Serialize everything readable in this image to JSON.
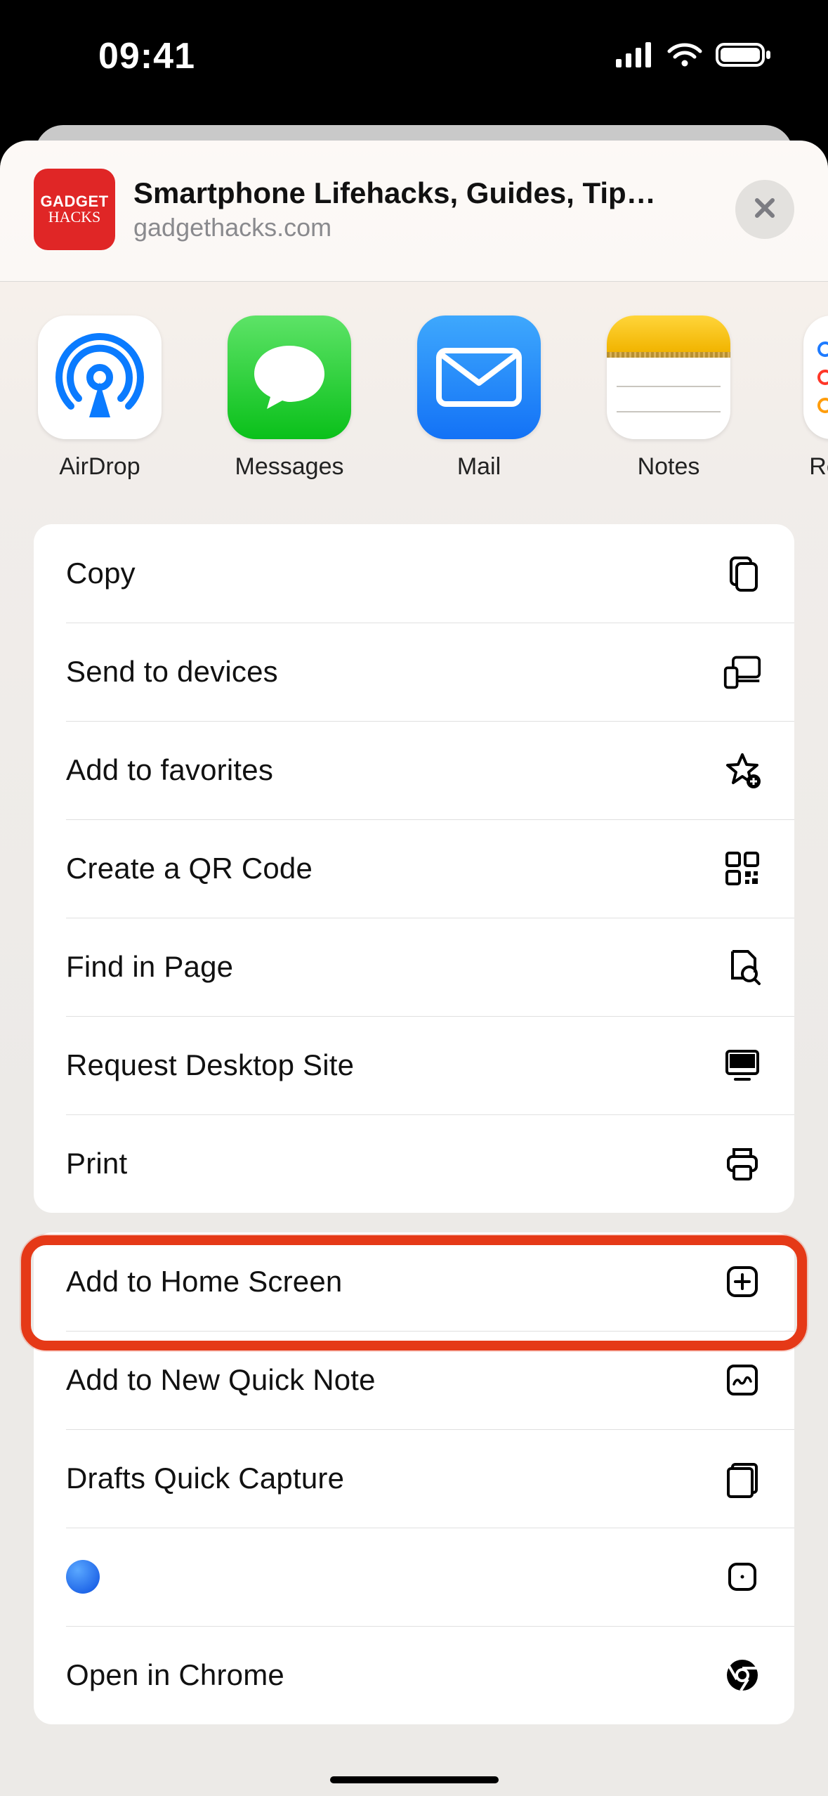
{
  "status": {
    "time": "09:41"
  },
  "header": {
    "site_icon_line1": "GADGET",
    "site_icon_line2": "HACKS",
    "title": "Smartphone Lifehacks, Guides, Tips, Tric...",
    "subtitle": "gadgethacks.com"
  },
  "share_targets": [
    {
      "id": "airdrop",
      "label": "AirDrop",
      "icon": "airdrop-icon"
    },
    {
      "id": "messages",
      "label": "Messages",
      "icon": "messages-icon"
    },
    {
      "id": "mail",
      "label": "Mail",
      "icon": "mail-icon"
    },
    {
      "id": "notes",
      "label": "Notes",
      "icon": "notes-icon"
    },
    {
      "id": "reminders",
      "label": "Re",
      "icon": "reminders-icon"
    }
  ],
  "actions_group1": [
    {
      "id": "copy",
      "label": "Copy",
      "icon": "copy-icon"
    },
    {
      "id": "send-devices",
      "label": "Send to devices",
      "icon": "devices-icon"
    },
    {
      "id": "add-favorites",
      "label": "Add to favorites",
      "icon": "star-plus-icon"
    },
    {
      "id": "qr-code",
      "label": "Create a QR Code",
      "icon": "qr-icon"
    },
    {
      "id": "find-in-page",
      "label": "Find in Page",
      "icon": "find-page-icon"
    },
    {
      "id": "desktop-site",
      "label": "Request Desktop Site",
      "icon": "desktop-icon"
    },
    {
      "id": "print",
      "label": "Print",
      "icon": "print-icon"
    }
  ],
  "actions_group2": [
    {
      "id": "add-home-screen",
      "label": "Add to Home Screen",
      "icon": "plus-box-icon",
      "highlighted": true
    },
    {
      "id": "quick-note",
      "label": "Add to New Quick Note",
      "icon": "quicknote-icon"
    },
    {
      "id": "drafts-capture",
      "label": "Drafts Quick Capture",
      "icon": "drafts-icon"
    },
    {
      "id": "blank-dot",
      "label": "",
      "icon": "dot-box-icon"
    },
    {
      "id": "open-chrome",
      "label": "Open in Chrome",
      "icon": "chrome-icon"
    }
  ]
}
